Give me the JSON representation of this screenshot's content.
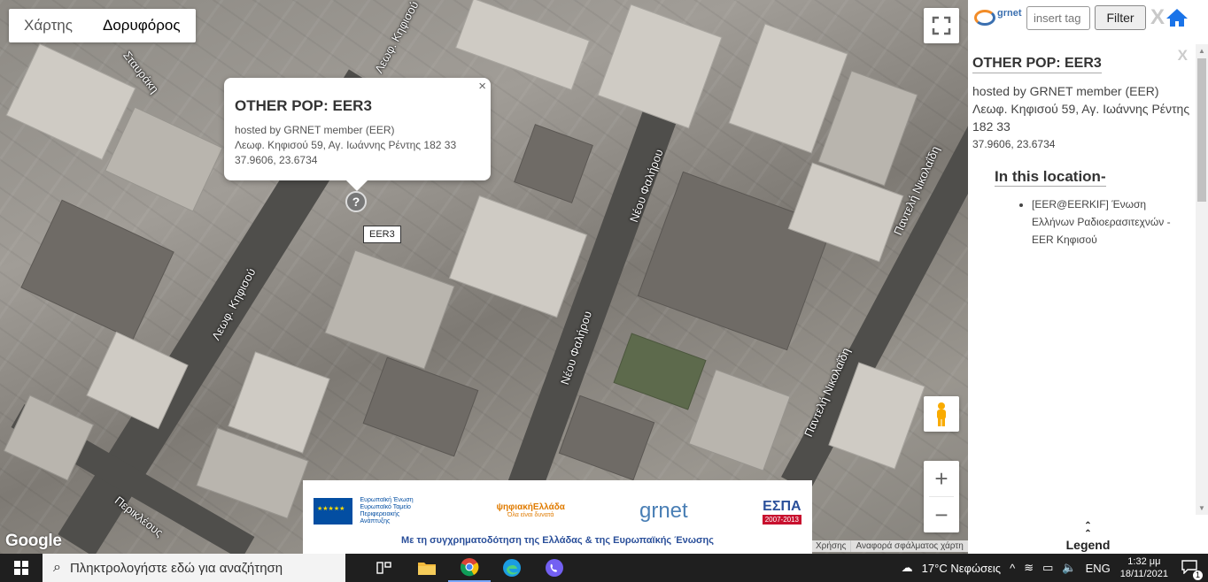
{
  "map": {
    "type_tabs": [
      "Χάρτης",
      "Δορυφόρος"
    ],
    "active_type": "Δορυφόρος",
    "road_labels": [
      "Σταυράκη",
      "Λεωφ. Κηφισού",
      "Νέου Φαλήρου",
      "Νέου Φαλήρου",
      "Παντελή Νικολαΐδη",
      "Παντελή Νικολαΐδη",
      "Περικλέους",
      "Λεωφ. Κηφισού"
    ],
    "popup": {
      "title": "OTHER POP: EER3",
      "line1": "hosted by GRNET member (EER)",
      "line2": "Λεωφ. Κηφισού 59, Αγ. Ιωάννης Ρέντης 182 33",
      "line3": "37.9606, 23.6734",
      "close": "×"
    },
    "marker_symbol": "?",
    "marker_label": "EER3",
    "zoom_in": "+",
    "zoom_out": "−",
    "google_logo": "Google",
    "footer_links": [
      "Χρήσης",
      "Αναφορά σφάλματος χάρτη"
    ],
    "banner": {
      "eu_text": "Ευρωπαϊκή Ένωση Ευρωπαϊκό Ταμείο Περιφερειακής Ανάπτυξης",
      "psifiaki_title": "ψηφιακήΕλλάδα",
      "psifiaki_sub": "Όλα είναι δυνατά",
      "grnet": "grnet",
      "espa": "ΕΣΠΑ",
      "espa_years": "2007-2013",
      "caption": "Με τη συγχρηματοδότηση της Ελλάδας & της Ευρωπαϊκής Ένωσης"
    }
  },
  "sidebar": {
    "logo_text": "grnet",
    "tag_placeholder": "insert tag",
    "filter_label": "Filter",
    "clear_label": "X",
    "panel_close": "X",
    "title": "OTHER POP: EER3",
    "hosted": "hosted by GRNET member (EER)",
    "address": "Λεωφ. Κηφισού 59, Αγ. Ιωάννης Ρέντης 182 33",
    "coords": "37.9606, 23.6734",
    "location_heading": "In this location-",
    "location_items": [
      "[EER@EERKIF] Ένωση Ελλήνων Ραδιοερασιτεχνών - EER Κηφισού"
    ],
    "legend_label": "Legend",
    "colors": {
      "accent": "#1a73e8",
      "home": "#1a73e8"
    }
  },
  "taskbar": {
    "search_placeholder": "Πληκτρολογήστε εδώ για αναζήτηση",
    "weather": "17°C  Νεφώσεις",
    "language": "ENG",
    "time": "1:32 μμ",
    "date": "18/11/2021",
    "notification_count": "1",
    "apps": [
      "task-view-icon",
      "file-explorer-icon",
      "chrome-icon",
      "edge-icon",
      "viber-icon"
    ]
  }
}
